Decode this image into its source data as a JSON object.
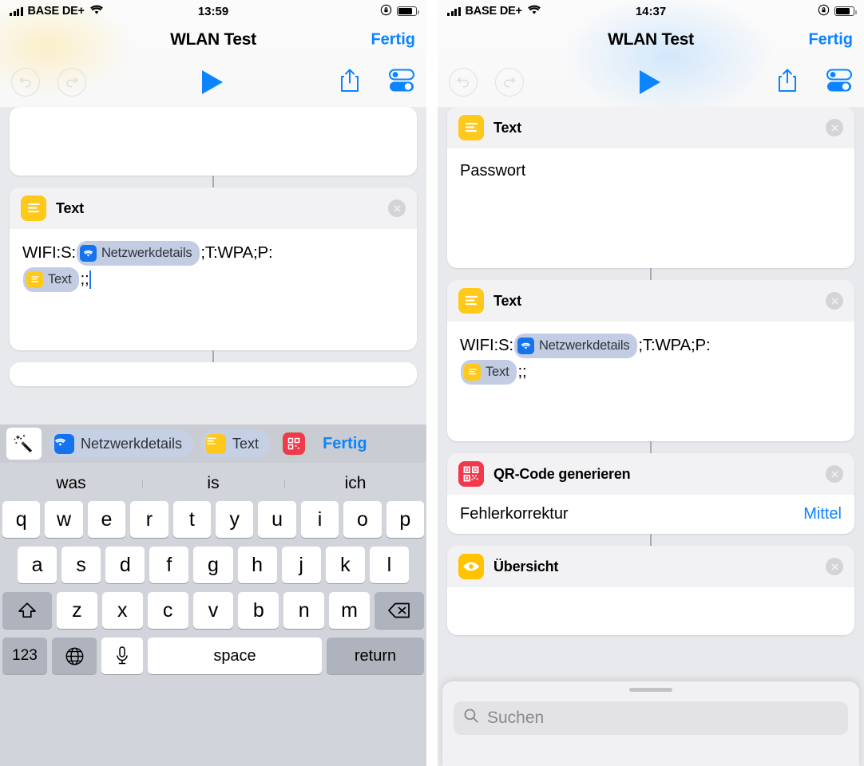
{
  "left": {
    "status": {
      "carrier": "BASE DE+",
      "time": "13:59",
      "wifi_icon": "wifi-icon",
      "rotation_lock_icon": "rotation-lock-icon",
      "battery_icon": "battery-icon"
    },
    "nav": {
      "title": "WLAN Test",
      "done_label": "Fertig"
    },
    "toolbar": {
      "undo_icon": "undo-icon",
      "redo_icon": "redo-icon",
      "play_icon": "play-icon",
      "share_icon": "share-icon",
      "settings_icon": "toggles-icon"
    },
    "text_card": {
      "title": "Text",
      "icon": "text-action-icon",
      "close_icon": "close-icon",
      "prefix": "WIFI:S:",
      "token_network": "Netzwerkdetails",
      "middle": ";T:WPA;P:",
      "token_text": "Text",
      "suffix": ";;"
    },
    "varbar": {
      "wand_icon": "magic-wand-icon",
      "chip_network": "Netzwerkdetails",
      "chip_text": "Text",
      "qr_icon": "qr-code-icon",
      "done_label": "Fertig"
    },
    "keyboard": {
      "predictions": [
        "was",
        "is",
        "ich"
      ],
      "row1": [
        "q",
        "w",
        "e",
        "r",
        "t",
        "y",
        "u",
        "i",
        "o",
        "p"
      ],
      "row2": [
        "a",
        "s",
        "d",
        "f",
        "g",
        "h",
        "j",
        "k",
        "l"
      ],
      "row3": [
        "z",
        "x",
        "c",
        "v",
        "b",
        "n",
        "m"
      ],
      "shift_icon": "shift-icon",
      "backspace_icon": "backspace-icon",
      "numbers_label": "123",
      "globe_icon": "globe-icon",
      "mic_icon": "microphone-icon",
      "space_label": "space",
      "return_label": "return"
    }
  },
  "right": {
    "status": {
      "carrier": "BASE DE+",
      "time": "14:37",
      "wifi_icon": "wifi-icon",
      "rotation_lock_icon": "rotation-lock-icon",
      "battery_icon": "battery-icon"
    },
    "nav": {
      "title": "WLAN Test",
      "done_label": "Fertig"
    },
    "toolbar": {
      "undo_icon": "undo-icon",
      "redo_icon": "redo-icon",
      "play_icon": "play-icon",
      "share_icon": "share-icon",
      "settings_icon": "toggles-icon"
    },
    "card_password": {
      "title": "Text",
      "icon": "text-action-icon",
      "close_icon": "close-icon",
      "body": "Passwort"
    },
    "card_wifi": {
      "title": "Text",
      "icon": "text-action-icon",
      "close_icon": "close-icon",
      "prefix": "WIFI:S:",
      "token_network": "Netzwerkdetails",
      "middle": ";T:WPA;P:",
      "token_text": "Text",
      "suffix": ";;"
    },
    "card_qr": {
      "title": "QR-Code generieren",
      "icon": "qr-code-icon",
      "close_icon": "close-icon",
      "row_label": "Fehlerkorrektur",
      "row_value": "Mittel"
    },
    "card_overview": {
      "title": "Übersicht",
      "icon": "eye-icon",
      "close_icon": "close-icon"
    },
    "sheet": {
      "search_placeholder": "Suchen",
      "search_icon": "search-icon",
      "grabber": "sheet-grabber"
    }
  },
  "colors": {
    "accent_blue": "#0a84ff",
    "token_blue": "#c2cde3",
    "glyph_yellow": "#ffc91c",
    "glyph_red": "#f2394c",
    "glyph_amber": "#ffc300",
    "canvas_bg": "#e8e9ec",
    "keyboard_bg": "#d1d4da"
  }
}
